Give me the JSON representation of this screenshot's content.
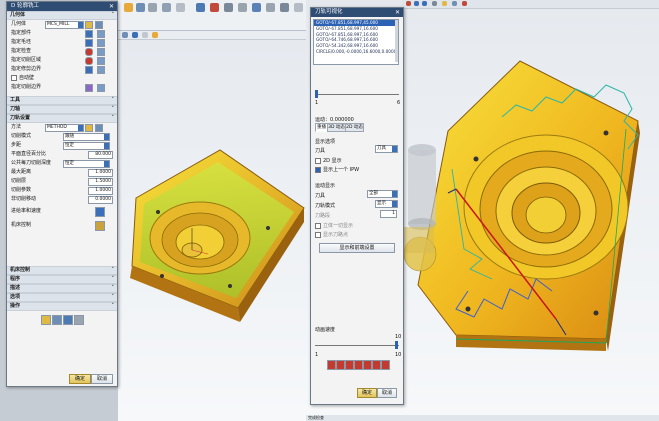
{
  "left_window": {
    "dialog_title": "D  轮廓铣工",
    "section_geometry": "几何体",
    "geometry_label": "几何体",
    "geometry_value": "MCS_MILL",
    "rows": [
      {
        "label": "指定部件"
      },
      {
        "label": "指定毛坯"
      },
      {
        "label": "指定检查"
      },
      {
        "label": "指定切削区域"
      },
      {
        "label": "指定修剪边界"
      }
    ],
    "wall_check_label": "自动壁",
    "cut_boundary_label": "指定切削边界",
    "collapsed_sections": [
      "工具",
      "刀轴",
      "刀轨设置"
    ],
    "method_label": "方法",
    "method_value": "METHOD",
    "fields": [
      {
        "label": "切削模式",
        "value": "跟随",
        "type": "select"
      },
      {
        "label": "步距",
        "value": "恒定",
        "type": "select"
      },
      {
        "label": "平面直径百分比",
        "value": "80.000",
        "type": "number"
      },
      {
        "label": "公共每刀切削深度",
        "value": "恒定",
        "type": "select"
      },
      {
        "label": "最大距离",
        "value": "1.0000",
        "type": "number"
      }
    ],
    "param_rows": [
      {
        "label": "切削层",
        "value": "1.5000"
      },
      {
        "label": "切削参数",
        "value": "1.0000"
      },
      {
        "label": "非切削移动",
        "value": "0.0000"
      }
    ],
    "icon_rows": [
      "进给率和速度",
      "机床控制"
    ],
    "bottom_sections": [
      "机床控制",
      "程序",
      "描述",
      "选项",
      "操作"
    ],
    "ok_label": "确定",
    "cancel_label": "取消"
  },
  "right_window": {
    "dialog_title": "刀轨可视化",
    "list_items": [
      "GOTO/-67.851,68.997,45.000",
      "GOTO/-67.851,68.997,16.600",
      "GOTO/-67.851,68.997,16.600",
      "GOTO/-64.746,68.997,16.600",
      "GOTO/-54.342,68.997,16.600",
      "CIRCLE/0.000,-0.0000,16.6000,0.0000000,-0.0"
    ],
    "slider_min": "1",
    "slider_max": "6",
    "motion_label": "运动：0.000000",
    "tabs": [
      "重播",
      "3D 动态",
      "2D 动态"
    ],
    "display_label": "显示选项",
    "tool_label": "刀具",
    "tool_value": "刀具",
    "check_items": [
      "2D 显示",
      "显示上一个 IPW"
    ],
    "motion_display_label": "运动显示",
    "motion_tool_label": "刀具",
    "motion_tool_value": "全部",
    "tool_path_label": "刀轨模式",
    "tool_path_value": "显示",
    "path_sub_label": "刀路段",
    "path_sub_value": "1",
    "extra_checks": [
      "立体一切显示",
      "显示刀路点"
    ],
    "show_lines_button": "显示和前端设置",
    "speed_label": "动画速度",
    "speed_min": "1",
    "speed_max": "10",
    "speed_top": "10",
    "ok_label": "确定",
    "cancel_label": "取消",
    "status_text": "完成检查"
  }
}
